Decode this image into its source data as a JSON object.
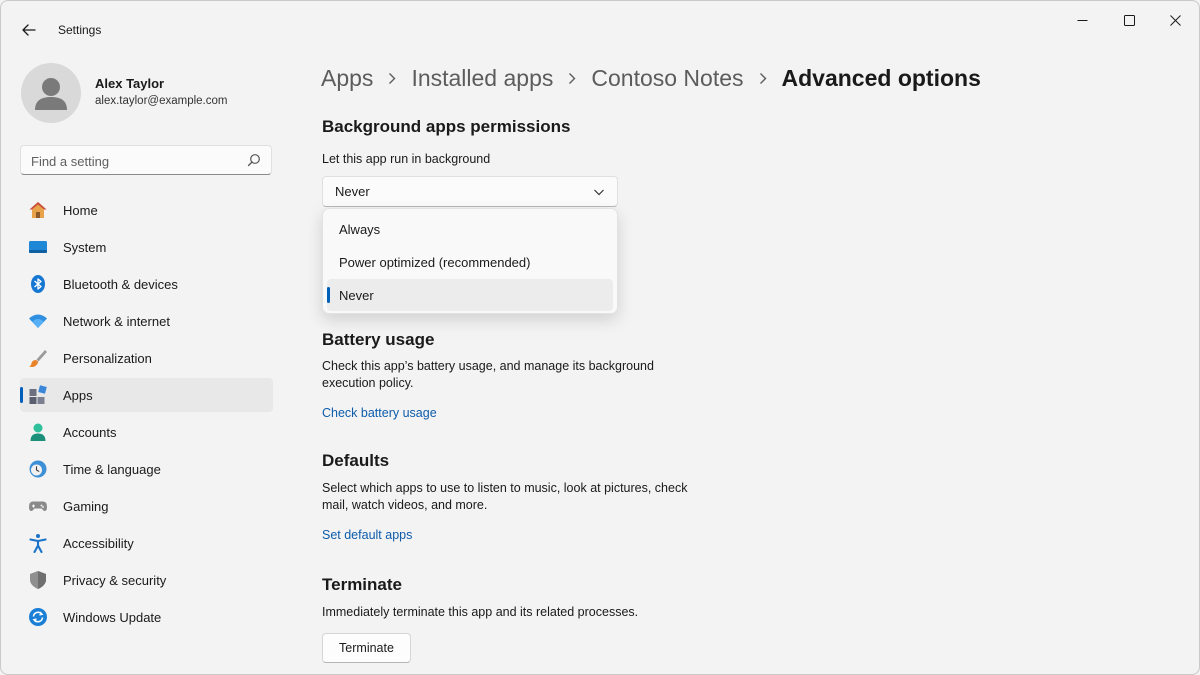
{
  "window": {
    "title": "Settings",
    "controls": [
      "minimize",
      "maximize",
      "close"
    ]
  },
  "profile": {
    "name": "Alex Taylor",
    "email": "alex.taylor@example.com"
  },
  "search": {
    "placeholder": "Find a setting",
    "value": ""
  },
  "sidebar": {
    "items": [
      {
        "label": "Home",
        "icon": "home-icon"
      },
      {
        "label": "System",
        "icon": "system-icon"
      },
      {
        "label": "Bluetooth & devices",
        "icon": "bluetooth-icon"
      },
      {
        "label": "Network & internet",
        "icon": "wifi-icon"
      },
      {
        "label": "Personalization",
        "icon": "brush-icon"
      },
      {
        "label": "Apps",
        "icon": "apps-icon",
        "active": true
      },
      {
        "label": "Accounts",
        "icon": "person-icon"
      },
      {
        "label": "Time & language",
        "icon": "clock-globe-icon"
      },
      {
        "label": "Gaming",
        "icon": "gamepad-icon"
      },
      {
        "label": "Accessibility",
        "icon": "accessibility-icon"
      },
      {
        "label": "Privacy & security",
        "icon": "shield-icon"
      },
      {
        "label": "Windows Update",
        "icon": "update-icon"
      }
    ]
  },
  "breadcrumb": [
    "Apps",
    "Installed apps",
    "Contoso Notes",
    "Advanced options"
  ],
  "background": {
    "title": "Background apps permissions",
    "label": "Let this app run in background",
    "selected": "Never",
    "options": [
      "Always",
      "Power optimized (recommended)",
      "Never"
    ]
  },
  "battery": {
    "title": "Battery usage",
    "description": "Check this app’s battery usage, and manage its background execution policy.",
    "link": "Check battery usage"
  },
  "defaults": {
    "title": "Defaults",
    "description": "Select which apps to use to listen to music, look at pictures, check mail, watch videos, and more.",
    "link": "Set default apps"
  },
  "terminate": {
    "title": "Terminate",
    "description": "Immediately terminate this app and its related processes.",
    "button": "Terminate"
  },
  "colors": {
    "accent": "#005fb8",
    "link": "#0d5cab",
    "background": "#f3f3f3"
  }
}
